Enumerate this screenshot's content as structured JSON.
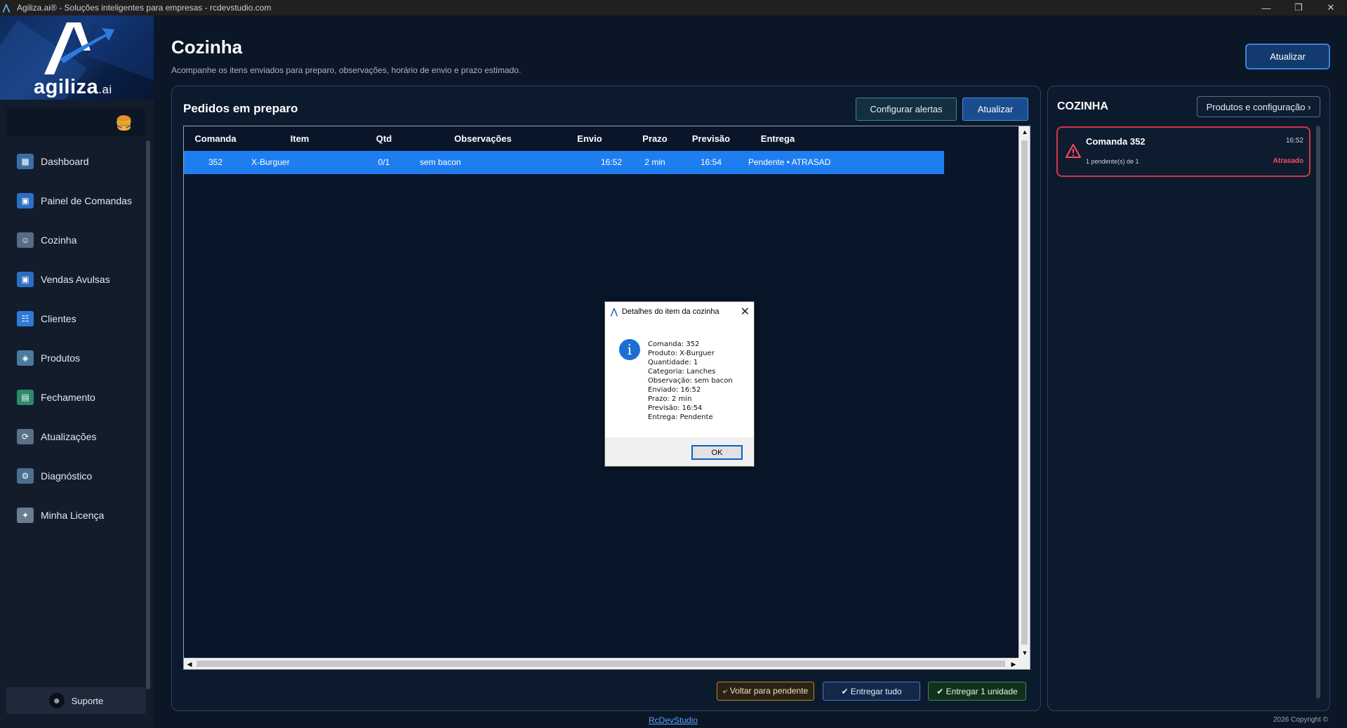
{
  "window": {
    "title": "Agiliza.ai® - Soluções inteligentes para empresas - rcdevstudio.com",
    "controls": [
      "—",
      "❐",
      "✕"
    ]
  },
  "brand": {
    "name": "agiliza",
    "suffix": ".ai"
  },
  "sidebar": {
    "items": [
      {
        "label": "Dashboard",
        "icon": "dashboard-icon",
        "color": "#3a6ea5"
      },
      {
        "label": "Painel de Comandas",
        "icon": "panel-icon",
        "color": "#2a6fc2"
      },
      {
        "label": "Cozinha",
        "icon": "chef-icon",
        "color": "#5a6b85"
      },
      {
        "label": "Vendas Avulsas",
        "icon": "sales-icon",
        "color": "#2a6fc2"
      },
      {
        "label": "Clientes",
        "icon": "clients-icon",
        "color": "#2f7ad6"
      },
      {
        "label": "Produtos",
        "icon": "products-icon",
        "color": "#4a7a9e"
      },
      {
        "label": "Fechamento",
        "icon": "closing-icon",
        "color": "#2e8a6a"
      },
      {
        "label": "Atualizações",
        "icon": "updates-icon",
        "color": "#5a7086"
      },
      {
        "label": "Diagnóstico",
        "icon": "diagnostic-icon",
        "color": "#4d6f8e"
      },
      {
        "label": "Minha Licença",
        "icon": "license-icon",
        "color": "#6a7c90"
      }
    ],
    "support_label": "Suporte"
  },
  "header": {
    "title": "Cozinha",
    "subtitle": "Acompanhe os itens enviados para preparo, observações, horário de envio e prazo estimado.",
    "refresh_label": "Atualizar"
  },
  "main": {
    "title": "Pedidos em preparo",
    "config_label": "Configurar alertas",
    "refresh_label": "Atualizar",
    "columns": [
      "Comanda",
      "Item",
      "Qtd",
      "Observações",
      "Envio",
      "Prazo",
      "Previsão",
      "Entrega"
    ],
    "rows": [
      [
        "352",
        "X-Burguer",
        "0/1",
        "sem bacon",
        "16:52",
        "2 min",
        "16:54",
        "Pendente • ATRASAD"
      ]
    ],
    "back_label": "⤶ Voltar para pendente",
    "deliver_all_label": "✔ Entregar tudo",
    "deliver_one_label": "✔ Entregar 1 unidade"
  },
  "right": {
    "title": "COZINHA",
    "products_label": "Produtos e configuração ›",
    "card": {
      "title": "Comanda 352",
      "time": "16:52",
      "pending": "1 pendente(s) de 1",
      "status": "Atrasado"
    }
  },
  "footer": {
    "link": "RcDevStudio",
    "copyright": "2026 Copyright ©"
  },
  "dialog": {
    "title": "Detalhes do item da cozinha",
    "lines": [
      "Comanda: 352",
      "Produto: X-Burguer",
      "Quantidade: 1",
      "Categoria: Lanches",
      "Observação: sem bacon",
      "Enviado: 16:52",
      "Prazo: 2 min",
      "Previsão: 16:54",
      "Entrega: Pendente"
    ],
    "ok_label": "OK"
  }
}
